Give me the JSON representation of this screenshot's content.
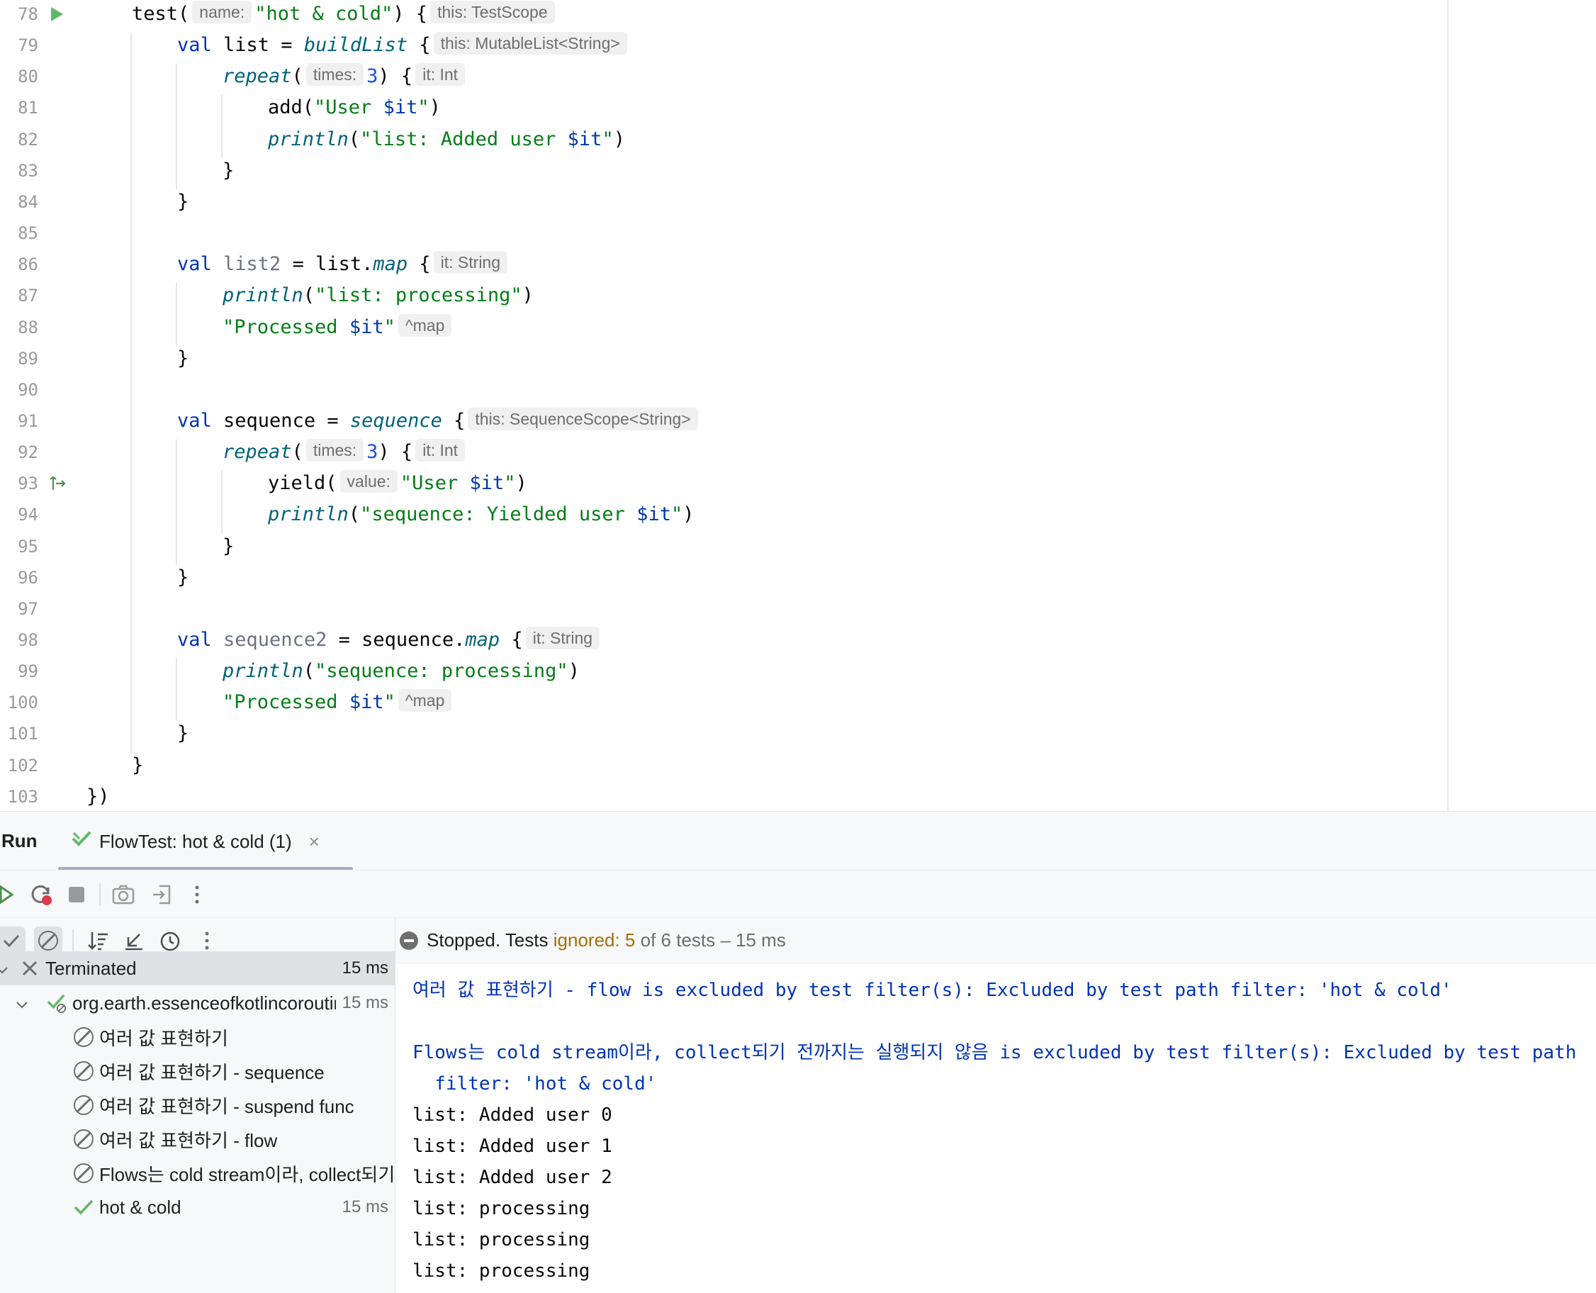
{
  "editor": {
    "lines": [
      {
        "num": "78",
        "indent": 0,
        "gutter": "run-icon",
        "segments": [
          [
            "n",
            "test("
          ],
          [
            "h",
            "name:"
          ],
          [
            "s",
            "\"hot & cold\""
          ],
          [
            "n",
            ") {"
          ],
          [
            "h",
            "this: TestScope"
          ]
        ]
      },
      {
        "num": "79",
        "indent": 1,
        "segments": [
          [
            "k",
            "val "
          ],
          [
            "n",
            "list = "
          ],
          [
            "f",
            "buildList"
          ],
          [
            "n",
            " {"
          ],
          [
            "h",
            "this: MutableList<String>"
          ]
        ]
      },
      {
        "num": "80",
        "indent": 2,
        "segments": [
          [
            "f",
            "repeat"
          ],
          [
            "n",
            "("
          ],
          [
            "h",
            "times:"
          ],
          [
            "d",
            "3"
          ],
          [
            "n",
            ") {"
          ],
          [
            "h",
            "it: Int"
          ]
        ]
      },
      {
        "num": "81",
        "indent": 3,
        "segments": [
          [
            "n",
            "add("
          ],
          [
            "s",
            "\"User "
          ],
          [
            "t",
            "$it"
          ],
          [
            "s",
            "\""
          ],
          [
            "n",
            ")"
          ]
        ]
      },
      {
        "num": "82",
        "indent": 3,
        "segments": [
          [
            "f",
            "println"
          ],
          [
            "n",
            "("
          ],
          [
            "s",
            "\"list: Added user "
          ],
          [
            "t",
            "$it"
          ],
          [
            "s",
            "\""
          ],
          [
            "n",
            ")"
          ]
        ]
      },
      {
        "num": "83",
        "indent": 2,
        "segments": [
          [
            "n",
            "}"
          ]
        ]
      },
      {
        "num": "84",
        "indent": 1,
        "segments": [
          [
            "n",
            "}"
          ]
        ]
      },
      {
        "num": "85",
        "indent": 1,
        "segments": []
      },
      {
        "num": "86",
        "indent": 1,
        "segments": [
          [
            "k",
            "val "
          ],
          [
            "u",
            "list2"
          ],
          [
            "n",
            " = list."
          ],
          [
            "f",
            "map"
          ],
          [
            "n",
            " {"
          ],
          [
            "h",
            "it: String"
          ]
        ]
      },
      {
        "num": "87",
        "indent": 2,
        "segments": [
          [
            "f",
            "println"
          ],
          [
            "n",
            "("
          ],
          [
            "s",
            "\"list: processing\""
          ],
          [
            "n",
            ")"
          ]
        ]
      },
      {
        "num": "88",
        "indent": 2,
        "segments": [
          [
            "s",
            "\"Processed "
          ],
          [
            "t",
            "$it"
          ],
          [
            "s",
            "\""
          ],
          [
            "h",
            "^map"
          ]
        ]
      },
      {
        "num": "89",
        "indent": 1,
        "segments": [
          [
            "n",
            "}"
          ]
        ]
      },
      {
        "num": "90",
        "indent": 1,
        "segments": []
      },
      {
        "num": "91",
        "indent": 1,
        "segments": [
          [
            "k",
            "val "
          ],
          [
            "n",
            "sequence = "
          ],
          [
            "f",
            "sequence"
          ],
          [
            "n",
            " {"
          ],
          [
            "h",
            "this: SequenceScope<String>"
          ]
        ]
      },
      {
        "num": "92",
        "indent": 2,
        "segments": [
          [
            "f",
            "repeat"
          ],
          [
            "n",
            "("
          ],
          [
            "h",
            "times:"
          ],
          [
            "d",
            "3"
          ],
          [
            "n",
            ") {"
          ],
          [
            "h",
            "it: Int"
          ]
        ]
      },
      {
        "num": "93",
        "indent": 3,
        "gutter": "suspend-icon",
        "segments": [
          [
            "n",
            "yield("
          ],
          [
            "h",
            "value:"
          ],
          [
            "s",
            "\"User "
          ],
          [
            "t",
            "$it"
          ],
          [
            "s",
            "\""
          ],
          [
            "n",
            ")"
          ]
        ]
      },
      {
        "num": "94",
        "indent": 3,
        "segments": [
          [
            "f",
            "println"
          ],
          [
            "n",
            "("
          ],
          [
            "s",
            "\"sequence: Yielded user "
          ],
          [
            "t",
            "$it"
          ],
          [
            "s",
            "\""
          ],
          [
            "n",
            ")"
          ]
        ]
      },
      {
        "num": "95",
        "indent": 2,
        "segments": [
          [
            "n",
            "}"
          ]
        ]
      },
      {
        "num": "96",
        "indent": 1,
        "segments": [
          [
            "n",
            "}"
          ]
        ]
      },
      {
        "num": "97",
        "indent": 1,
        "segments": []
      },
      {
        "num": "98",
        "indent": 1,
        "segments": [
          [
            "k",
            "val "
          ],
          [
            "u",
            "sequence2"
          ],
          [
            "n",
            " = sequence."
          ],
          [
            "f",
            "map"
          ],
          [
            "n",
            " {"
          ],
          [
            "h",
            "it: String"
          ]
        ]
      },
      {
        "num": "99",
        "indent": 2,
        "segments": [
          [
            "f",
            "println"
          ],
          [
            "n",
            "("
          ],
          [
            "s",
            "\"sequence: processing\""
          ],
          [
            "n",
            ")"
          ]
        ]
      },
      {
        "num": "100",
        "indent": 2,
        "segments": [
          [
            "s",
            "\"Processed "
          ],
          [
            "t",
            "$it"
          ],
          [
            "s",
            "\""
          ],
          [
            "h",
            "^map"
          ]
        ]
      },
      {
        "num": "101",
        "indent": 1,
        "segments": [
          [
            "n",
            "}"
          ]
        ]
      },
      {
        "num": "102",
        "indent": 0,
        "segments": [
          [
            "n",
            "}"
          ]
        ]
      },
      {
        "num": "103",
        "indent": -1,
        "segments": [
          [
            "n",
            "})"
          ]
        ]
      }
    ]
  },
  "run_window": {
    "title": "Run",
    "tab_label": "FlowTest: hot & cold (1)",
    "status": {
      "prefix": "Stopped. Tests ",
      "ignored": "ignored: 5",
      "suffix": " of 6 tests – 15 ms"
    },
    "tree": [
      {
        "label": "Terminated",
        "time": "15 ms",
        "icon": "x-icon",
        "level": 0,
        "selected": true
      },
      {
        "label": "org.earth.essenceofkotlincoroutines",
        "time": "15 ms",
        "icon": "check-partial-icon",
        "level": 1
      },
      {
        "label": "여러 값 표현하기",
        "time": "",
        "icon": "ignored-icon",
        "level": 2
      },
      {
        "label": "여러 값 표현하기 - sequence",
        "time": "",
        "icon": "ignored-icon",
        "level": 2
      },
      {
        "label": "여러 값 표현하기 - suspend func",
        "time": "",
        "icon": "ignored-icon",
        "level": 2
      },
      {
        "label": "여러 값 표현하기 - flow",
        "time": "",
        "icon": "ignored-icon",
        "level": 2
      },
      {
        "label": "Flows는 cold stream이라, collect되기",
        "time": "",
        "icon": "ignored-icon",
        "level": 2
      },
      {
        "label": "hot & cold",
        "time": "15 ms",
        "icon": "check-icon",
        "level": 2
      }
    ],
    "console": [
      {
        "text": "여러 값 표현하기 - flow is excluded by test filter(s): Excluded by test path filter: 'hot & cold'",
        "style": "blue"
      },
      {
        "text": "",
        "style": "plain"
      },
      {
        "text": "Flows는 cold stream이라, collect되기 전까지는 실행되지 않음 is excluded by test filter(s): Excluded by test path",
        "style": "blue"
      },
      {
        "text": "  filter: 'hot & cold'",
        "style": "blue"
      },
      {
        "text": "list: Added user 0",
        "style": "plain"
      },
      {
        "text": "list: Added user 1",
        "style": "plain"
      },
      {
        "text": "list: Added user 2",
        "style": "plain"
      },
      {
        "text": "list: processing",
        "style": "plain"
      },
      {
        "text": "list: processing",
        "style": "plain"
      },
      {
        "text": "list: processing",
        "style": "plain"
      }
    ]
  },
  "colors": {
    "keyword": "#0033b3",
    "string": "#067d17",
    "function": "#00627a",
    "number": "#1750eb",
    "success": "#5fb865",
    "ignored": "#a86e00"
  }
}
